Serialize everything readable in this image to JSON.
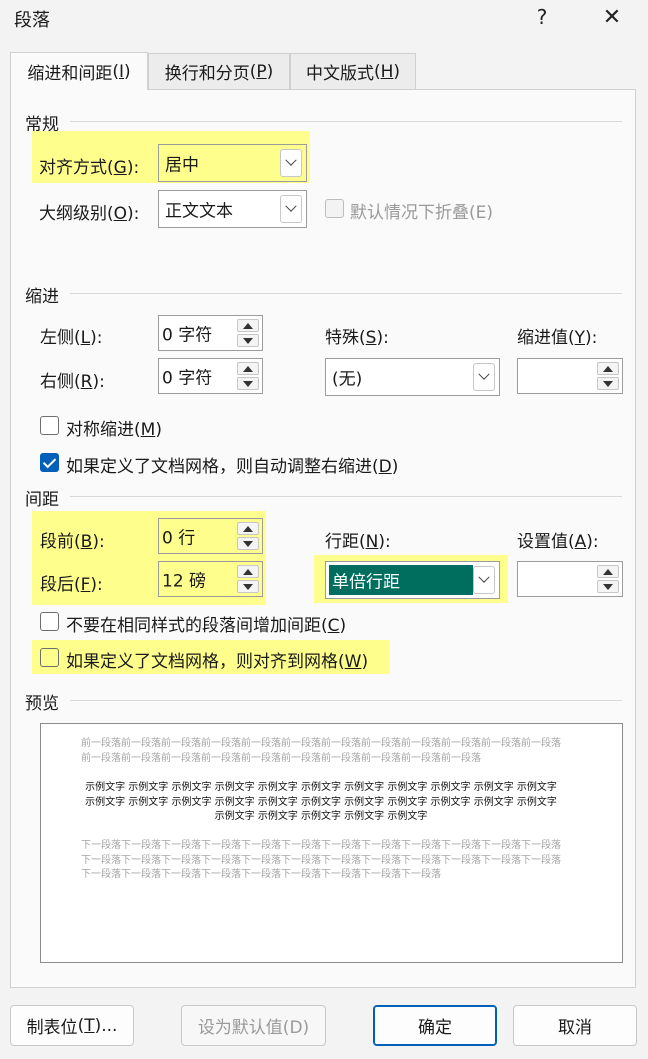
{
  "title": "段落",
  "titlebar": {
    "help": "?",
    "close": "✕"
  },
  "tabs": [
    {
      "label": "缩进和间距",
      "accel": "I"
    },
    {
      "label": "换行和分页",
      "accel": "P"
    },
    {
      "label": "中文版式",
      "accel": "H"
    }
  ],
  "general": {
    "section": "常规",
    "alignment": {
      "label": "对齐方式",
      "accel": "G",
      "colon": ":",
      "value": "居中"
    },
    "outline": {
      "label": "大纲级别",
      "accel": "O",
      "colon": ":",
      "value": "正文文本"
    },
    "collapse": {
      "label": "默认情况下折叠(E)"
    }
  },
  "indent": {
    "section": "缩进",
    "left": {
      "label": "左侧",
      "accel": "L",
      "colon": "):",
      "value": "0 字符"
    },
    "right": {
      "label": "右侧",
      "accel": "R",
      "colon": "):",
      "value": "0 字符"
    },
    "special": {
      "label": "特殊",
      "accel": "S",
      "colon": "):",
      "value": "(无)"
    },
    "by": {
      "label": "缩进值",
      "accel": "Y",
      "colon": "):",
      "value": ""
    },
    "mirror": {
      "label": "对称缩进",
      "accel": "M"
    },
    "auto_adjust": {
      "label": "如果定义了文档网格，则自动调整右缩进",
      "accel": "D"
    }
  },
  "spacing": {
    "section": "间距",
    "before": {
      "label": "段前",
      "accel": "B",
      "colon": "):",
      "value": "0 行"
    },
    "after": {
      "label": "段后",
      "accel": "F",
      "colon": "):",
      "value": "12 磅"
    },
    "line": {
      "label": "行距",
      "accel": "N",
      "colon": "):",
      "value": "单倍行距"
    },
    "at": {
      "label": "设置值",
      "accel": "A",
      "colon": "):",
      "value": ""
    },
    "no_space_same": {
      "label": "不要在相同样式的段落间增加间距",
      "accel": "C"
    },
    "snap_grid": {
      "label": "如果定义了文档网格，则对齐到网格",
      "accel": "W"
    }
  },
  "preview": {
    "section": "预览",
    "prev_text": "前一段落前一段落前一段落前一段落前一段落前一段落前一段落前一段落前一段落前一段落前一段落前一段落前一段落前一段落前一段落前一段落前一段落前一段落前一段落前一段落前一段落前一段落",
    "sample_text": "示例文字 示例文字 示例文字 示例文字 示例文字 示例文字 示例文字 示例文字 示例文字 示例文字 示例文字 示例文字 示例文字 示例文字 示例文字 示例文字 示例文字 示例文字 示例文字 示例文字 示例文字 示例文字 示例文字 示例文字 示例文字 示例文字 示例文字",
    "next_text": "下一段落下一段落下一段落下一段落下一段落下一段落下一段落下一段落下一段落下一段落下一段落下一段落下一段落下一段落下一段落下一段落下一段落下一段落下一段落下一段落下一段落下一段落下一段落下一段落下一段落下一段落下一段落下一段落下一段落下一段落下一段落下一段落下一段落"
  },
  "buttons": {
    "tabs": {
      "label": "制表位",
      "accel": "T",
      "suffix": ")..."
    },
    "set_default": {
      "label": "设为默认值(D)"
    },
    "ok": {
      "label": "确定"
    },
    "cancel": {
      "label": "取消"
    }
  },
  "colors": {
    "highlight": "#fefe8c",
    "selected_fill": "#006e5f",
    "accent": "#005fb8"
  }
}
